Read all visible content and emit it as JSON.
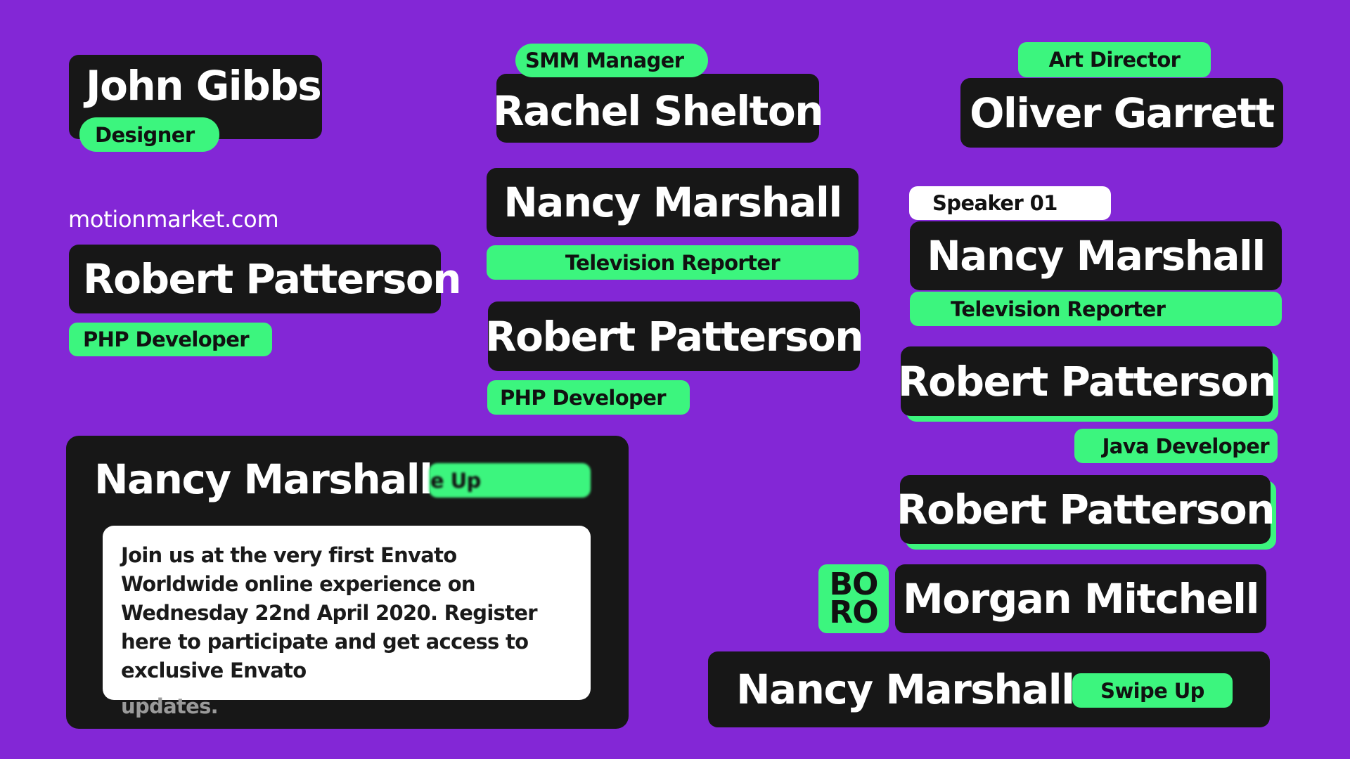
{
  "colors": {
    "background": "#8327d6",
    "card_dark": "#171717",
    "accent_green": "#3cf57e",
    "text_white": "#ffffff",
    "text_dark": "#111111"
  },
  "lower_thirds": {
    "john": {
      "name": "John Gibbs",
      "role": "Designer"
    },
    "rachel": {
      "name": "Rachel Shelton",
      "role": "SMM Manager"
    },
    "oliver": {
      "name": "Oliver Garrett",
      "role": "Art Director"
    },
    "robert_left": {
      "website": "motionmarket.com",
      "name": "Robert Patterson",
      "role": "PHP Developer"
    },
    "nancy_mid": {
      "name": "Nancy Marshall",
      "role": "Television Reporter"
    },
    "robert_mid": {
      "name": "Robert Patterson",
      "role": "PHP Developer"
    },
    "nancy_right": {
      "tag": "Speaker 01",
      "name": "Nancy Marshall",
      "role": "Television Reporter"
    },
    "robert_right_1": {
      "name": "Robert Patterson",
      "role": "Java Developer"
    },
    "robert_right_2": {
      "name": "Robert Patterson"
    },
    "morgan": {
      "logo_line1": "BO",
      "logo_line2": "RO",
      "name": "Morgan Mitchell"
    },
    "nancy_swipe": {
      "name": "Nancy Marshall",
      "button": "Swipe Up"
    },
    "nancy_card": {
      "name": "Nancy Marshall",
      "button_partial": "e Up",
      "body": "Join us at the very first Envato Worldwide online experience on Wednesday 22nd April 2020. Register here to participate and get access to exclusive Envato",
      "body_faded": "updates."
    }
  }
}
